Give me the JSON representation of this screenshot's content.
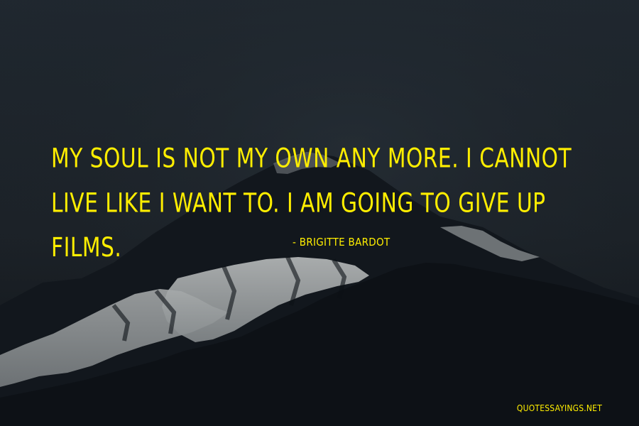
{
  "quote": {
    "text": "My soul is not my own any more. I cannot live like I want to. I am going to give up films.",
    "author": "- Brigitte Bardot"
  },
  "footer": {
    "watermark": "QUOTESSAYINGS.NET"
  },
  "colors": {
    "text": "#ffee00",
    "sky": "#1f252b",
    "snow": "#a7aaaa",
    "mountain": "#11161c"
  }
}
